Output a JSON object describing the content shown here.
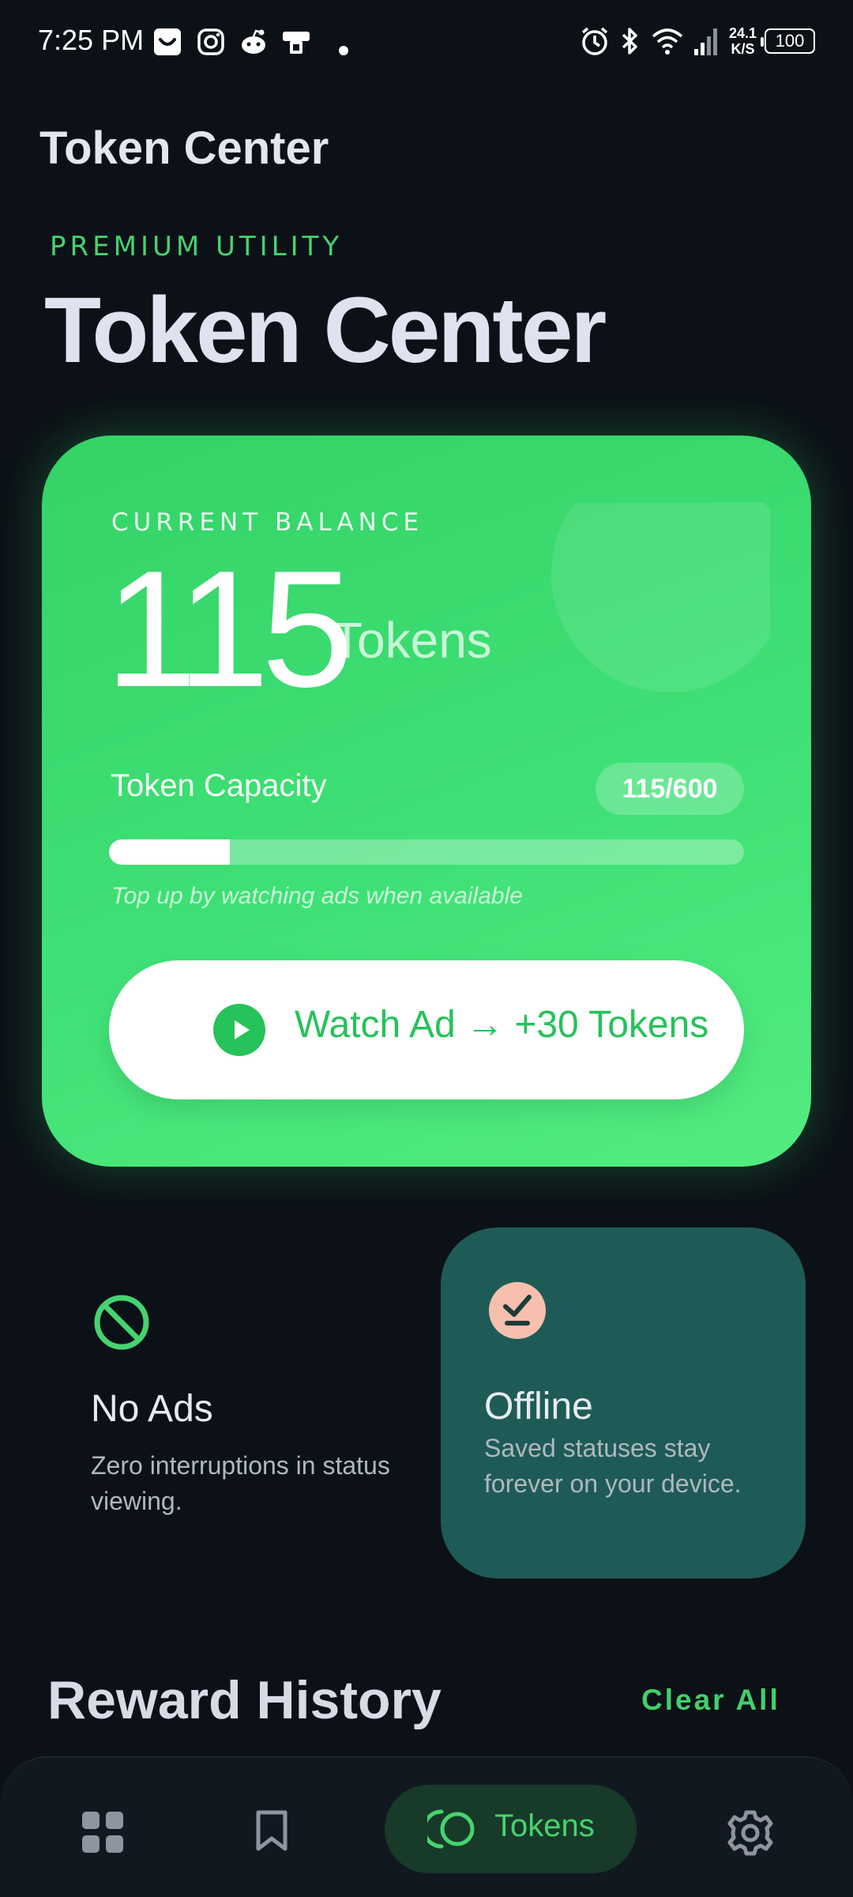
{
  "status_bar": {
    "time": "7:25 PM",
    "net_speed_value": "24.1",
    "net_speed_unit": "K/S",
    "battery": "100",
    "left_icons": [
      "bag-notification-icon",
      "instagram-icon",
      "reddit-icon",
      "transit-app-icon",
      "dot-icon"
    ],
    "right_icons": [
      "alarm-icon",
      "bluetooth-icon",
      "wifi-icon",
      "signal-icon",
      "battery-icon"
    ]
  },
  "header": {
    "app_title": "Token Center",
    "eyebrow": "PREMIUM UTILITY",
    "hero_title": "Token Center"
  },
  "balance": {
    "label": "CURRENT BALANCE",
    "value": "115",
    "unit": "Tokens",
    "capacity_label": "Token Capacity",
    "capacity_pill": "115/600",
    "capacity_fraction": 0.19,
    "hint": "Top up by watching ads when available",
    "watch_button": "Watch Ad → +30 Tokens"
  },
  "features": [
    {
      "title": "No Ads",
      "description": "Zero interruptions in status viewing.",
      "icon": "no-ads-icon"
    },
    {
      "title": "Offline",
      "description": "Saved statuses stay forever on your device.",
      "icon": "offline-save-icon"
    }
  ],
  "reward_history": {
    "title": "Reward History",
    "clear_label": "Clear All"
  },
  "bottom_nav": {
    "items": [
      {
        "icon": "grid-icon"
      },
      {
        "icon": "bookmark-icon"
      },
      {
        "icon": "tokens-icon",
        "label": "Tokens",
        "active": true
      },
      {
        "icon": "gear-icon"
      }
    ]
  },
  "colors": {
    "background": "#0c1117",
    "accent_green": "#46d36f",
    "card_green": "#3fe076",
    "offline_card": "#1f5b56",
    "nav_active_bg": "#173a29"
  }
}
